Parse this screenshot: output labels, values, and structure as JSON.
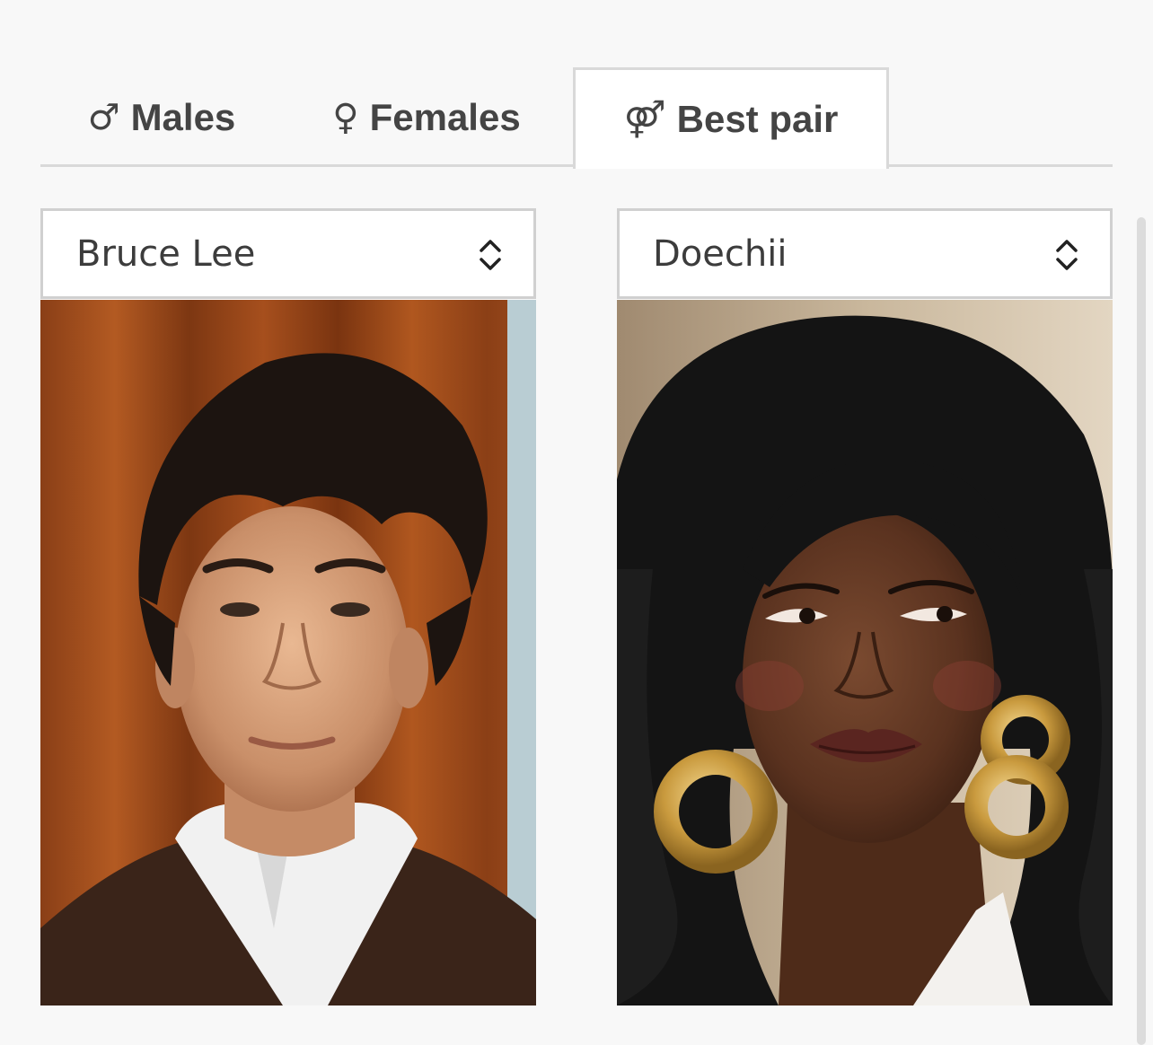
{
  "tabs": [
    {
      "symbol": "♂",
      "label": "Males",
      "active": false
    },
    {
      "symbol": "♀",
      "label": "Females",
      "active": false
    },
    {
      "symbol": "⚤",
      "label": "Best pair",
      "active": true
    }
  ],
  "pair": {
    "male": {
      "selected": "Bruce Lee"
    },
    "female": {
      "selected": "Doechii"
    }
  },
  "icons": {
    "select_arrow": "updown-chevron-icon"
  },
  "colors": {
    "background": "#f8f8f8",
    "border": "#d9d9d9",
    "text": "#444444"
  }
}
